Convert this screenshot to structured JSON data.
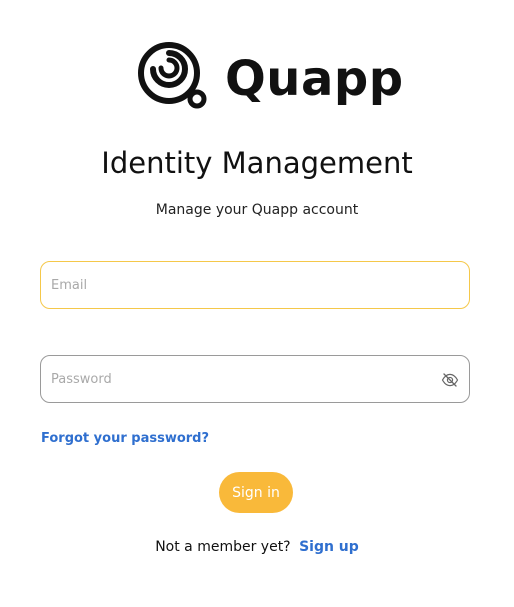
{
  "brand": {
    "name": "Quapp",
    "logo_icon": "quapp-spiral-logo-icon"
  },
  "header": {
    "title": "Identity Management",
    "subtitle": "Manage your Quapp account"
  },
  "form": {
    "email": {
      "placeholder": "Email",
      "value": ""
    },
    "password": {
      "placeholder": "Password",
      "value": "",
      "toggle_icon": "eye-slash-icon"
    },
    "forgot_label": "Forgot your password?",
    "submit_label": "Sign in"
  },
  "footer": {
    "question": "Not a member yet?",
    "signup_label": "Sign up"
  },
  "colors": {
    "accent": "#f9b93a",
    "link": "#2f6fcf",
    "focus_border": "#f5c84a",
    "text": "#111111"
  }
}
